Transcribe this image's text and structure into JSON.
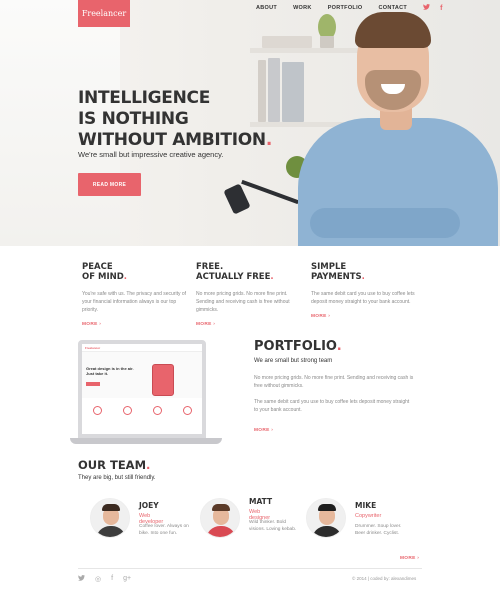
{
  "brand": {
    "name": "Freelancer",
    "accent": "#e8646c"
  },
  "nav": {
    "items": [
      "ABOUT",
      "WORK",
      "PORTFOLIO",
      "CONTACT"
    ],
    "social": [
      {
        "icon": "twitter-icon",
        "glyph": "🐦"
      },
      {
        "icon": "facebook-icon",
        "glyph": "f"
      }
    ]
  },
  "hero": {
    "title_lines": [
      "INTELLIGENCE",
      "IS NOTHING",
      "WITHOUT AMBITION"
    ],
    "title_dot": ".",
    "subtitle": "We're small but impressive creative agency.",
    "button": "READ MORE"
  },
  "features": [
    {
      "title_lines": [
        "PEACE",
        "OF MIND"
      ],
      "text": "You're safe with us. The privacy and security of your financial information always is our top priority.",
      "more": "MORE ›"
    },
    {
      "title_lines": [
        "FREE.",
        "ACTUALLY FREE"
      ],
      "text": "No more pricing grids. No more fine print. Sending and receiving cash is free without gimmicks.",
      "more": "MORE ›"
    },
    {
      "title_lines": [
        "SIMPLE",
        "PAYMENTS"
      ],
      "text": "The same debit card you use to buy coffee lets deposit money straight to your bank account.",
      "more": "MORE ›"
    }
  ],
  "laptop_screen": {
    "logo": "Freelancer",
    "headline": "Great design is in the air. Just take it."
  },
  "portfolio": {
    "title": "PORTFOLIO",
    "subtitle": "We are small but strong team",
    "paragraphs": [
      "No more pricing grids. No more fine print. Sending and receiving cash is free without gimmicks.",
      "The same debit card you use to buy coffee lets deposit money straight to your bank account."
    ],
    "more": "MORE ›"
  },
  "team": {
    "title": "OUR TEAM",
    "subtitle": "They are big, but still friendly.",
    "members": [
      {
        "name": "JOEY",
        "role": "Web developer",
        "desc": "Coffee lover. Always on bike. Into one fun."
      },
      {
        "name": "MATT",
        "role": "Web designer",
        "desc": "Wild thinker. Bold visions. Loving kebab."
      },
      {
        "name": "MIKE",
        "role": "Copywriter",
        "desc": "Drummer. Soup lover. Beer drinker. Cyclist."
      }
    ],
    "more": "MORE ›"
  },
  "footer": {
    "icons": [
      {
        "icon": "twitter-icon",
        "glyph": "🐦"
      },
      {
        "icon": "instagram-icon",
        "glyph": "◎"
      },
      {
        "icon": "facebook-icon",
        "glyph": "f"
      },
      {
        "icon": "googleplus-icon",
        "glyph": "g+"
      }
    ],
    "copyright": "© 2014 | coded by: alexandimes"
  }
}
